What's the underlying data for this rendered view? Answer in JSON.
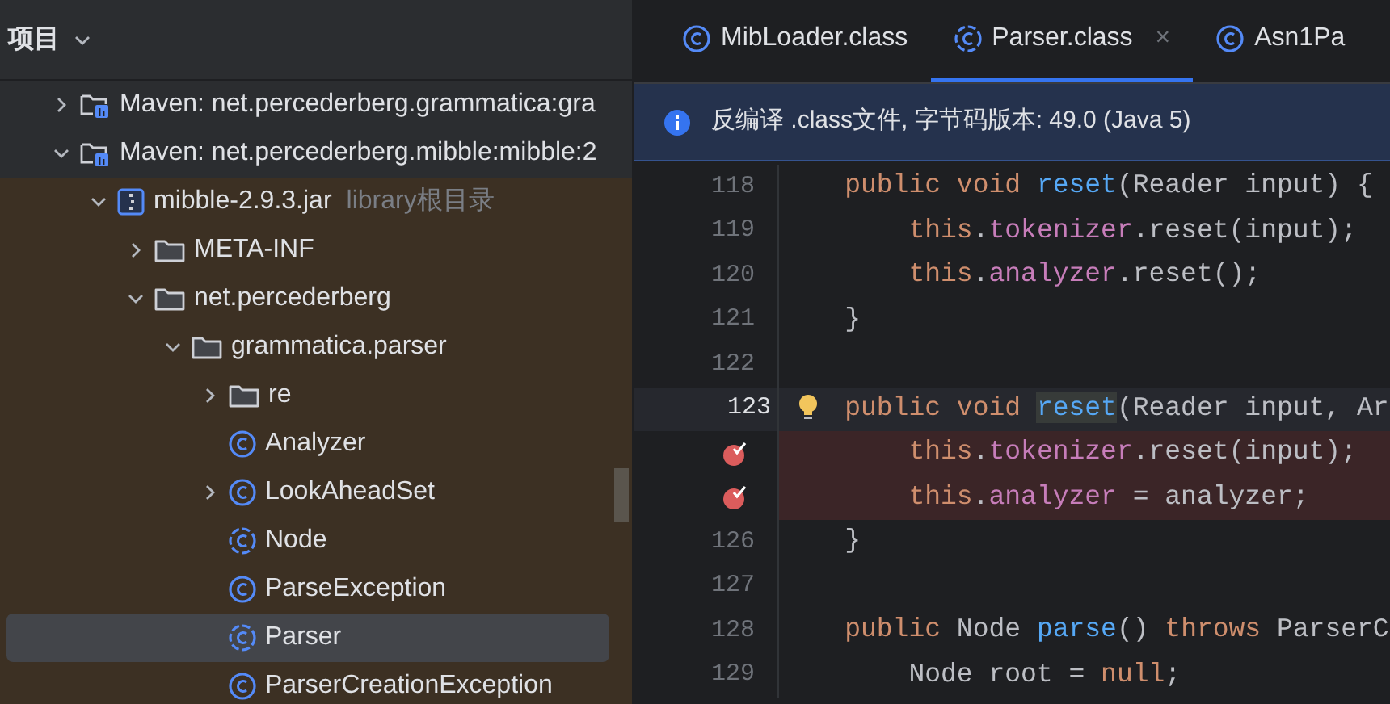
{
  "project_panel": {
    "title": "项目",
    "tree": [
      {
        "label": "Maven: net.percederberg.grammatica:gra",
        "kind": "library",
        "expanded": false,
        "selected": false
      },
      {
        "label": "Maven: net.percederberg.mibble:mibble:2",
        "kind": "library",
        "expanded": true,
        "selected": false,
        "children": [
          {
            "label": "mibble-2.9.3.jar",
            "hint": "library根目录",
            "kind": "jar",
            "expanded": true,
            "selected": false,
            "children": [
              {
                "label": "META-INF",
                "kind": "folder",
                "expanded": false,
                "selected": false
              },
              {
                "label": "net.percederberg",
                "kind": "folder",
                "expanded": true,
                "selected": false,
                "children": [
                  {
                    "label": "grammatica.parser",
                    "kind": "folder",
                    "expanded": true,
                    "selected": false,
                    "children": [
                      {
                        "label": "re",
                        "kind": "folder",
                        "expanded": false,
                        "selected": false
                      },
                      {
                        "label": "Analyzer",
                        "kind": "class",
                        "selected": false
                      },
                      {
                        "label": "LookAheadSet",
                        "kind": "class",
                        "expanded": false,
                        "selected": false
                      },
                      {
                        "label": "Node",
                        "kind": "abstract_class",
                        "selected": false
                      },
                      {
                        "label": "ParseException",
                        "kind": "class",
                        "selected": false
                      },
                      {
                        "label": "Parser",
                        "kind": "abstract_class",
                        "selected": true
                      },
                      {
                        "label": "ParserCreationException",
                        "kind": "class",
                        "selected": false
                      }
                    ]
                  }
                ]
              }
            ]
          }
        ]
      }
    ]
  },
  "editor": {
    "tabs": [
      {
        "label": "MibLoader.class",
        "kind": "class",
        "selected": false
      },
      {
        "label": "Parser.class",
        "kind": "abstract_class",
        "selected": true,
        "close": "×"
      },
      {
        "label": "Asn1Pa",
        "kind": "class",
        "selected": false
      }
    ],
    "banner": "反编译 .class文件, 字节码版本: 49.0 (Java 5)",
    "lines": [
      {
        "number": "118",
        "breakpoint": false,
        "current": false,
        "tokens": [
          {
            "text": "    public void ",
            "kind": "keyword"
          },
          {
            "text": "reset",
            "kind": "method"
          },
          {
            "text": "(Reader input) {",
            "kind": "plain"
          }
        ]
      },
      {
        "number": "119",
        "breakpoint": false,
        "current": false,
        "tokens": [
          {
            "text": "        this",
            "kind": "keyword"
          },
          {
            "text": ".",
            "kind": "plain"
          },
          {
            "text": "tokenizer",
            "kind": "field"
          },
          {
            "text": ".reset(input);",
            "kind": "plain"
          }
        ]
      },
      {
        "number": "120",
        "breakpoint": false,
        "current": false,
        "tokens": [
          {
            "text": "        this",
            "kind": "keyword"
          },
          {
            "text": ".",
            "kind": "plain"
          },
          {
            "text": "analyzer",
            "kind": "field"
          },
          {
            "text": ".reset();",
            "kind": "plain"
          }
        ]
      },
      {
        "number": "121",
        "breakpoint": false,
        "current": false,
        "tokens": [
          {
            "text": "    }",
            "kind": "plain"
          }
        ]
      },
      {
        "number": "122",
        "breakpoint": false,
        "current": false
      },
      {
        "number": "123",
        "breakpoint": false,
        "current": true,
        "tokens": [
          {
            "text": "    public void ",
            "kind": "keyword"
          },
          {
            "text": "reset",
            "kind": "usage"
          },
          {
            "text": "(Reader input, Ar",
            "kind": "plain"
          }
        ]
      },
      {
        "breakpoint": true,
        "current": false,
        "tokens": [
          {
            "text": "        this",
            "kind": "keyword"
          },
          {
            "text": ".",
            "kind": "plain"
          },
          {
            "text": "tokenizer",
            "kind": "field"
          },
          {
            "text": ".reset(input);",
            "kind": "plain"
          }
        ]
      },
      {
        "breakpoint": true,
        "current": false,
        "tokens": [
          {
            "text": "        this",
            "kind": "keyword"
          },
          {
            "text": ".",
            "kind": "plain"
          },
          {
            "text": "analyzer",
            "kind": "field"
          },
          {
            "text": " = analyzer;",
            "kind": "plain"
          }
        ]
      },
      {
        "number": "126",
        "breakpoint": false,
        "current": false,
        "tokens": [
          {
            "text": "    }",
            "kind": "plain"
          }
        ]
      },
      {
        "number": "127",
        "breakpoint": false,
        "current": false
      },
      {
        "number": "128",
        "breakpoint": false,
        "current": false,
        "tokens": [
          {
            "text": "    public ",
            "kind": "keyword"
          },
          {
            "text": "Node ",
            "kind": "plain"
          },
          {
            "text": "parse",
            "kind": "method"
          },
          {
            "text": "() ",
            "kind": "plain"
          },
          {
            "text": "throws ",
            "kind": "keyword"
          },
          {
            "text": "ParserC",
            "kind": "plain"
          }
        ]
      },
      {
        "number": "129",
        "breakpoint": false,
        "current": false,
        "tokens": [
          {
            "text": "        Node root = ",
            "kind": "plain"
          },
          {
            "text": "null",
            "kind": "keyword"
          },
          {
            "text": ";",
            "kind": "plain"
          }
        ]
      }
    ]
  }
}
